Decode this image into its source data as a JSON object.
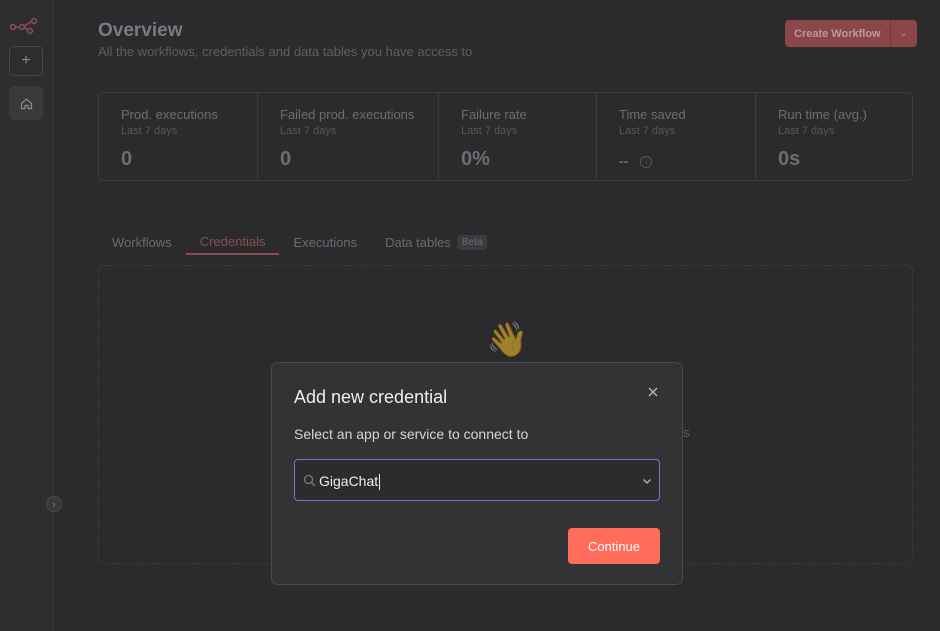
{
  "header": {
    "title": "Overview",
    "subtitle": "All the workflows, credentials and data tables you have access to",
    "create_label": "Create Workflow"
  },
  "stats": [
    {
      "title": "Prod. executions",
      "sub": "Last 7 days",
      "value": "0"
    },
    {
      "title": "Failed prod. executions",
      "sub": "Last 7 days",
      "value": "0"
    },
    {
      "title": "Failure rate",
      "sub": "Last 7 days",
      "value": "0%"
    },
    {
      "title": "Time saved",
      "sub": "Last 7 days",
      "value": "--"
    },
    {
      "title": "Run time (avg.)",
      "sub": "Last 7 days",
      "value": "0s"
    }
  ],
  "tabs": [
    {
      "label": "Workflows"
    },
    {
      "label": "Credentials",
      "active": true
    },
    {
      "label": "Executions"
    },
    {
      "label": "Data tables",
      "badge": "Beta"
    }
  ],
  "empty_state": {
    "emoji": "👋",
    "partial_text": "s"
  },
  "modal": {
    "title": "Add new credential",
    "subtitle": "Select an app or service to connect to",
    "search_value": "GigaChat",
    "continue_label": "Continue"
  },
  "colors": {
    "accent": "#ff6d5a",
    "focus_border": "#7d6fd0"
  }
}
